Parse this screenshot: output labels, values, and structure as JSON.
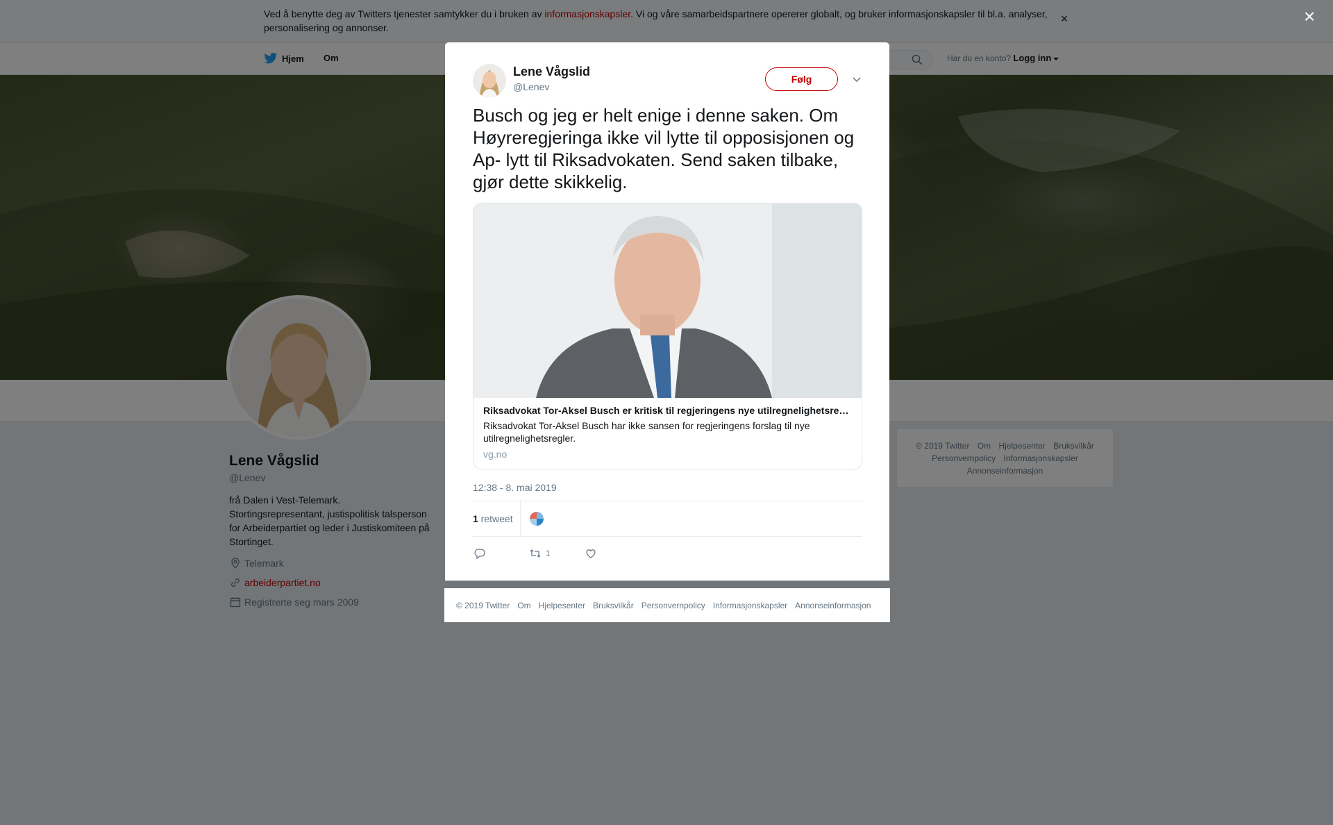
{
  "cookie": {
    "text_before": "Ved å benytte deg av Twitters tjenester samtykker du i bruken av ",
    "link": "informasjonskapsler",
    "text_after": ". Vi og våre samarbeidspartnere opererer globalt, og bruker informasjonskapsler til bl.a. analyser, personalisering og annonser.",
    "close": "×"
  },
  "nav": {
    "home": "Hjem",
    "about": "Om",
    "have_account": "Har du en konto?",
    "login": "Logg inn"
  },
  "profile": {
    "name": "Lene Vågslid",
    "handle": "@Lenev",
    "bio": "frå Dalen i Vest-Telemark. Stortingsrepresentant, justispolitisk talsperson for Arbeiderpartiet og leder i Justiskomiteen på Stortinget.",
    "location": "Telemark",
    "website": "arbeiderpartiet.no",
    "joined": "Registrerte seg mars 2009"
  },
  "sidebar_footer": {
    "links": [
      "© 2019 Twitter",
      "Om",
      "Hjelpesenter",
      "Bruksvilkår",
      "Personvernpolicy",
      "Informasjonskapsler",
      "Annonseinformasjon"
    ]
  },
  "overlay": {
    "close": "×"
  },
  "tweet": {
    "name": "Lene Vågslid",
    "handle": "@Lenev",
    "follow": "Følg",
    "text": "Busch og jeg er helt enige i denne saken. Om Høyreregjeringa ikke vil lytte til opposisjonen og Ap- lytt til Riksadvokaten. Send saken tilbake, gjør dette skikkelig.",
    "card": {
      "title": "Riksadvokat Tor-Aksel Busch er kritisk til regjeringens nye utilregnelighetsregler",
      "description": "Riksadvokat Tor-Aksel Busch har ikke sansen for regjeringens forslag til nye utilregnelighetsregler.",
      "domain": "vg.no"
    },
    "timestamp": "12:38 - 8. mai 2019",
    "retweet_count": "1",
    "retweet_label": " retweet",
    "actions": {
      "reply_count": "",
      "retweet_count": "1",
      "like_count": ""
    }
  },
  "modal_footer": {
    "links": [
      "© 2019 Twitter",
      "Om",
      "Hjelpesenter",
      "Bruksvilkår",
      "Personvernpolicy",
      "Informasjonskapsler",
      "Annonseinformasjon"
    ]
  },
  "colors": {
    "link": "#c00000",
    "accent": "#1da1f2"
  }
}
